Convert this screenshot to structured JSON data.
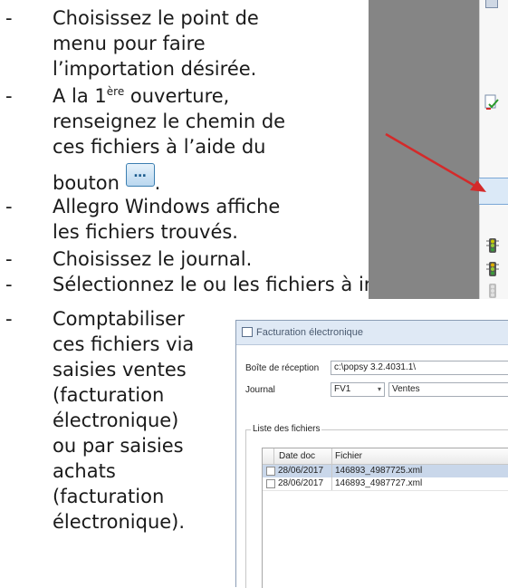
{
  "bullets": [
    {
      "dash": "-",
      "lines": [
        "Choisissez le point de",
        "menu pour faire",
        "l’importation désirée."
      ]
    },
    {
      "dash": "-",
      "line1_pre": "A la 1",
      "line1_sup": "ère",
      "line1_post": " ouverture,",
      "lines": [
        "renseignez le chemin de",
        "ces fichiers à l’aide du"
      ],
      "last_pre": "bouton",
      "last_post": "."
    },
    {
      "dash": "-",
      "lines": [
        "Allegro Windows affiche",
        "les fichiers trouvés."
      ]
    },
    {
      "dash": "-",
      "lines": [
        "Choisissez le journal."
      ]
    },
    {
      "dash": "-",
      "lines": [
        "Sélectionnez le ou les fichiers à importer."
      ]
    },
    {
      "dash": "-",
      "lines": [
        "Comptabiliser",
        "ces fichiers via",
        "saisies ventes",
        "(facturation",
        "électronique)",
        "ou par saisies",
        "achats",
        "(facturation",
        "électronique)."
      ]
    }
  ],
  "inline_button": {
    "glyph": "…",
    "icon": "browse-ellipsis-icon"
  },
  "colors": {
    "arrow": "#d42a2a",
    "panel_gray": "#858585",
    "selection": "#dbe9f7"
  },
  "dialog": {
    "title": "Facturation électronique",
    "fields": {
      "inbox_label": "Boîte de réception",
      "inbox_value": "c:\\popsy 3.2.4031.1\\",
      "journal_label": "Journal",
      "journal_code": "FV1",
      "journal_name": "Ventes"
    },
    "group_title": "Liste des fichiers",
    "columns": [
      "Date doc",
      "Fichier"
    ],
    "rows": [
      {
        "date": "28/06/2017",
        "file": "146893_4987725.xml",
        "selected": true
      },
      {
        "date": "28/06/2017",
        "file": "146893_4987727.xml",
        "selected": false
      }
    ]
  }
}
